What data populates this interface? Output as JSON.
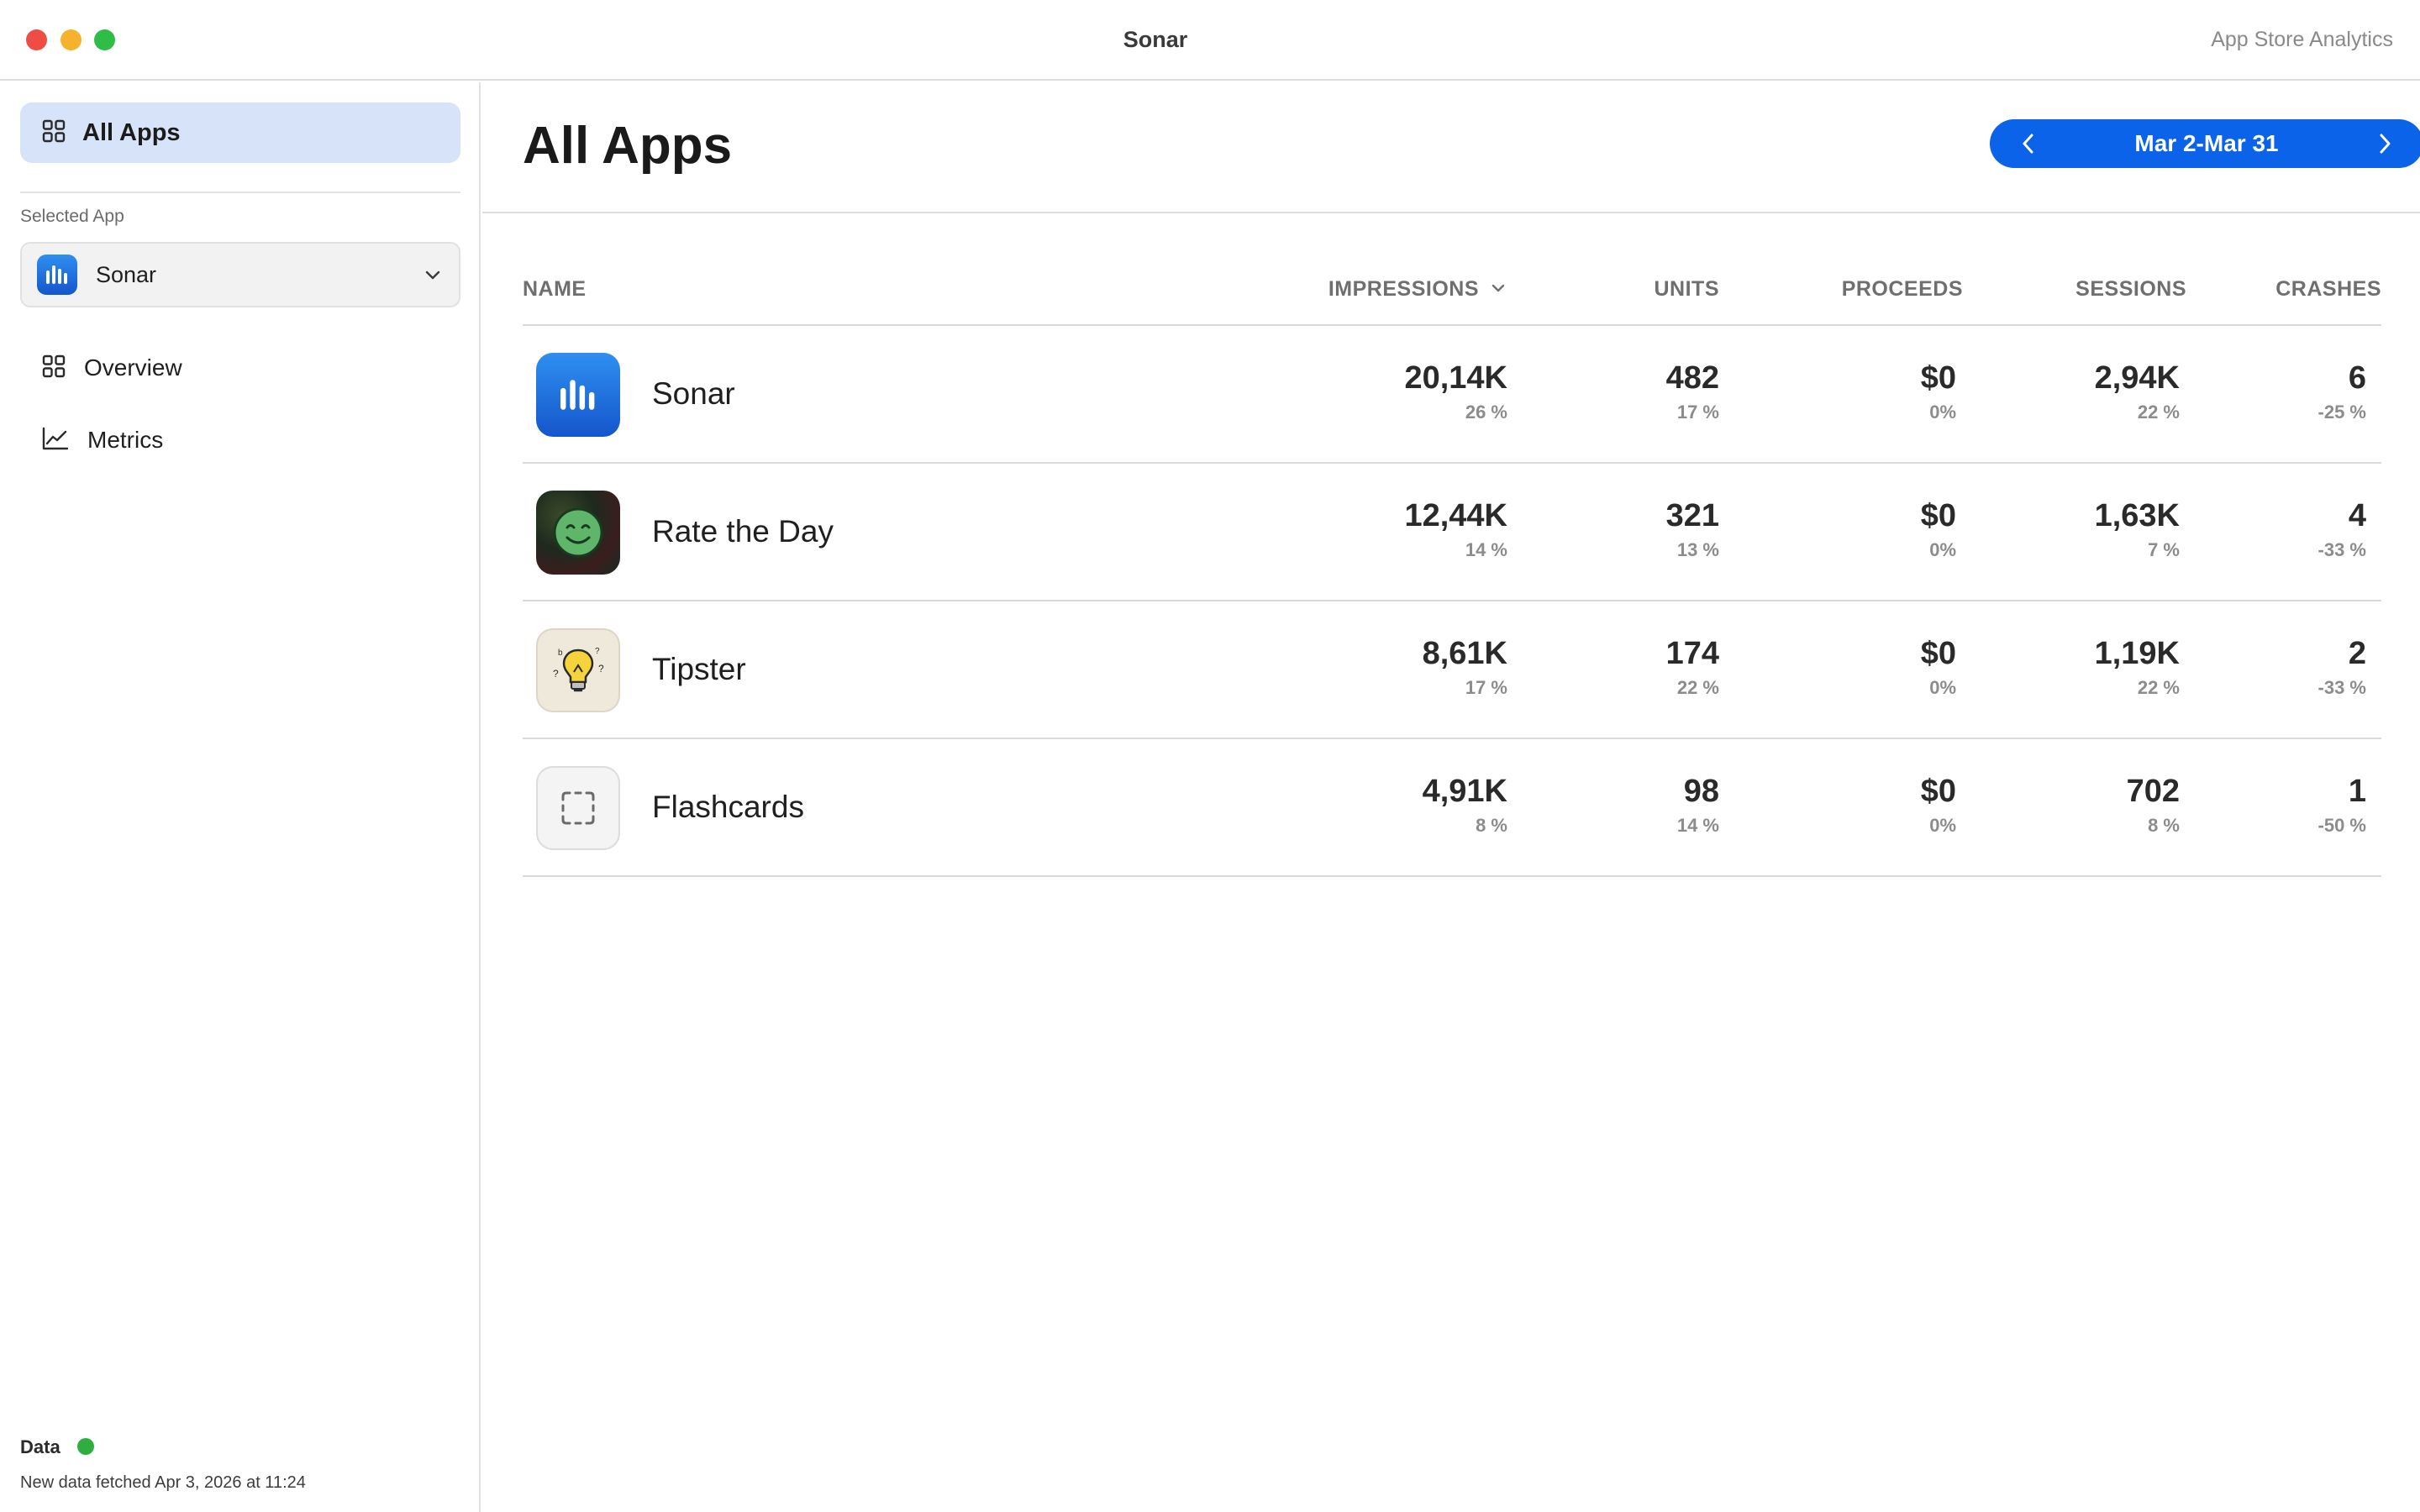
{
  "window": {
    "title": "Sonar",
    "subtitle": "App Store Analytics"
  },
  "sidebar": {
    "all_apps_label": "All Apps",
    "selected_app_section": "Selected App",
    "selected_app": "Sonar",
    "items": [
      {
        "label": "Overview",
        "icon": "grid-icon"
      },
      {
        "label": "Metrics",
        "icon": "chart-line-icon"
      }
    ],
    "status": {
      "label": "Data",
      "color": "#2fae3f",
      "text": "New data fetched Apr 3, 2026 at 11:24"
    }
  },
  "main": {
    "title": "All Apps",
    "date_range": "Mar 2-Mar 31",
    "accent": "#0a63e8",
    "columns": [
      "NAME",
      "IMPRESSIONS",
      "UNITS",
      "PROCEEDS",
      "SESSIONS",
      "CRASHES"
    ],
    "rows": [
      {
        "name": "Sonar",
        "icon": "sonar-app-icon",
        "impressions": "20,14K",
        "impressions_pct": "26 %",
        "units": "482",
        "units_pct": "17 %",
        "proceeds": "$0",
        "proceeds_pct": "0%",
        "sessions": "2,94K",
        "sessions_pct": "22 %",
        "crashes": "6",
        "crashes_pct": "-25 %"
      },
      {
        "name": "Rate the Day",
        "icon": "smiley-app-icon",
        "impressions": "12,44K",
        "impressions_pct": "14 %",
        "units": "321",
        "units_pct": "13 %",
        "proceeds": "$0",
        "proceeds_pct": "0%",
        "sessions": "1,63K",
        "sessions_pct": "7 %",
        "crashes": "4",
        "crashes_pct": "-33 %"
      },
      {
        "name": "Tipster",
        "icon": "lightbulb-app-icon",
        "impressions": "8,61K",
        "impressions_pct": "17 %",
        "units": "174",
        "units_pct": "22 %",
        "proceeds": "$0",
        "proceeds_pct": "0%",
        "sessions": "1,19K",
        "sessions_pct": "22 %",
        "crashes": "2",
        "crashes_pct": "-33 %"
      },
      {
        "name": "Flashcards",
        "icon": "placeholder-app-icon",
        "impressions": "4,91K",
        "impressions_pct": "8 %",
        "units": "98",
        "units_pct": "14 %",
        "proceeds": "$0",
        "proceeds_pct": "0%",
        "sessions": "702",
        "sessions_pct": "8 %",
        "crashes": "1",
        "crashes_pct": "-50 %"
      }
    ]
  }
}
